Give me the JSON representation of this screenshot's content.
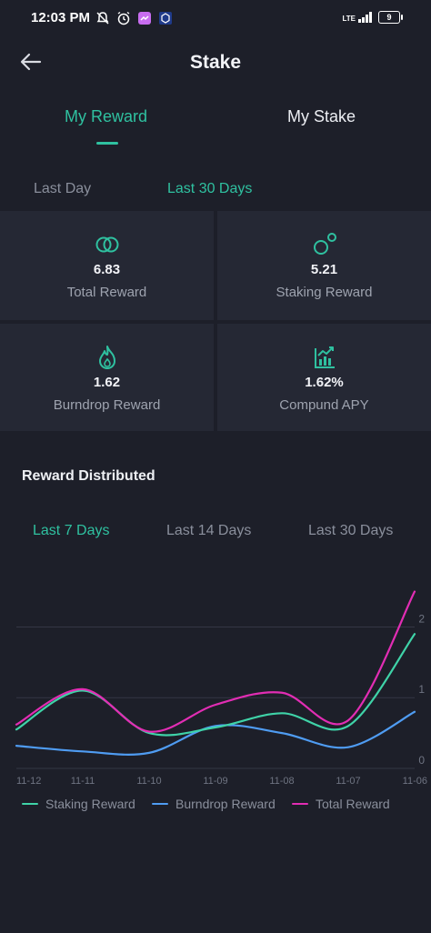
{
  "status_bar": {
    "time": "12:03 PM",
    "network": "LTE",
    "battery": "9"
  },
  "header": {
    "title": "Stake",
    "back_icon": "arrow-left-icon"
  },
  "tabs": [
    {
      "label": "My Reward",
      "active": true
    },
    {
      "label": "My Stake",
      "active": false
    }
  ],
  "time_filters": [
    {
      "label": "Last Day",
      "active": false
    },
    {
      "label": "Last 30 Days",
      "active": true
    }
  ],
  "stats": [
    {
      "value": "6.83",
      "label": "Total Reward",
      "icon": "rings-icon"
    },
    {
      "value": "5.21",
      "label": "Staking Reward",
      "icon": "nodes-icon"
    },
    {
      "value": "1.62",
      "label": "Burndrop Reward",
      "icon": "flame-icon"
    },
    {
      "value": "1.62%",
      "label": "Compund APY",
      "icon": "growth-chart-icon"
    }
  ],
  "reward_section": {
    "title": "Reward Distributed",
    "periods": [
      {
        "label": "Last 7 Days",
        "active": true
      },
      {
        "label": "Last 14 Days",
        "active": false
      },
      {
        "label": "Last 30 Days",
        "active": false
      }
    ]
  },
  "colors": {
    "accent": "#2fc1a0",
    "staking": "#3fd3a8",
    "burndrop": "#4f9cf2",
    "total": "#e22db4"
  },
  "chart_data": {
    "type": "line",
    "x": [
      "11-12",
      "11-11",
      "11-10",
      "11-09",
      "11-08",
      "11-07",
      "11-06"
    ],
    "yticks": [
      0,
      1,
      2
    ],
    "ylim": [
      0,
      2.7
    ],
    "grid": true,
    "legend_position": "bottom",
    "series": [
      {
        "name": "Staking Reward",
        "color": "#3fd3a8",
        "values": [
          0.55,
          1.1,
          0.5,
          0.58,
          0.78,
          0.6,
          1.9
        ]
      },
      {
        "name": "Burndrop Reward",
        "color": "#4f9cf2",
        "values": [
          0.32,
          0.24,
          0.22,
          0.6,
          0.5,
          0.3,
          0.8
        ]
      },
      {
        "name": "Total Reward",
        "color": "#e22db4",
        "values": [
          0.62,
          1.12,
          0.52,
          0.9,
          1.07,
          0.68,
          2.5
        ]
      }
    ]
  }
}
